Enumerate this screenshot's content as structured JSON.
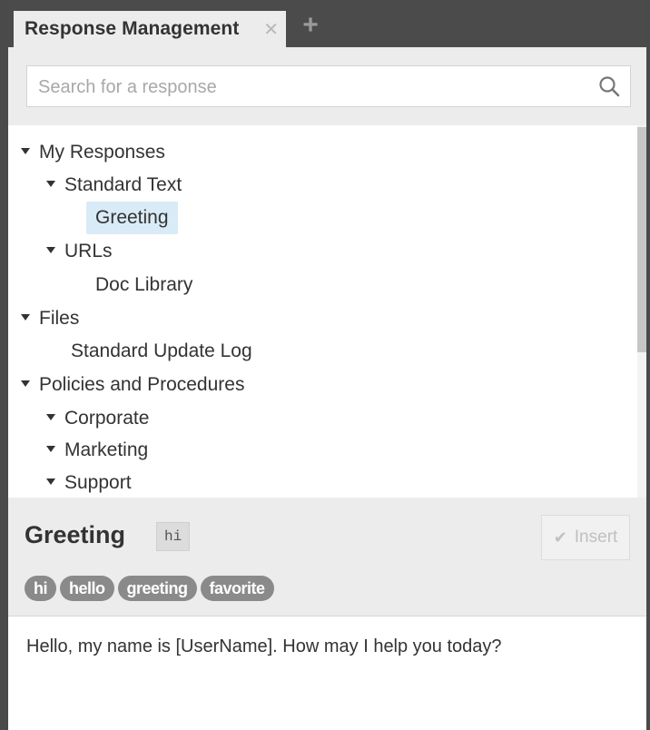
{
  "tabs": [
    {
      "label": "Response Management",
      "close_glyph": "✕"
    }
  ],
  "new_tab_glyph": "+",
  "search": {
    "placeholder": "Search for a response",
    "value": ""
  },
  "tree": [
    {
      "label": "My Responses",
      "level": 0,
      "expanded": true
    },
    {
      "label": "Standard Text",
      "level": 1,
      "expanded": true
    },
    {
      "label": "Greeting",
      "level": 2,
      "selected": true
    },
    {
      "label": "URLs",
      "level": 1,
      "expanded": true
    },
    {
      "label": "Doc Library",
      "level": 2
    },
    {
      "label": "Files",
      "level": 0,
      "expanded": true
    },
    {
      "label": "Standard Update Log",
      "level": 1
    },
    {
      "label": "Policies and Procedures",
      "level": 0,
      "expanded": true
    },
    {
      "label": "Corporate",
      "level": 1,
      "expanded": true
    },
    {
      "label": "Marketing",
      "level": 1,
      "expanded": true
    },
    {
      "label": "Support",
      "level": 1,
      "expanded": true
    }
  ],
  "detail": {
    "title": "Greeting",
    "shortcut": "hi",
    "insert_label": "Insert",
    "tags": [
      "hi",
      "hello",
      "greeting",
      "favorite"
    ],
    "body": "Hello, my name is [UserName].  How may I help you today?"
  },
  "colors": {
    "selected_bg": "#d9ebf7",
    "tag_bg": "#8a8a8a",
    "tab_strip": "#4b4b4b"
  }
}
